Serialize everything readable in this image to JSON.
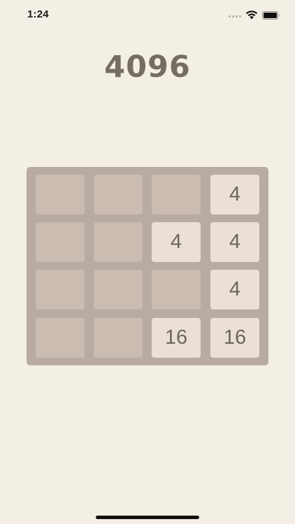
{
  "status_bar": {
    "time": "1:24",
    "icons": [
      "cellular-signal-icon",
      "wifi-icon",
      "battery-icon"
    ]
  },
  "game": {
    "title": "4096",
    "grid_size": 4,
    "tiles": [
      [
        "",
        "",
        "",
        "4"
      ],
      [
        "",
        "",
        "4",
        "4"
      ],
      [
        "",
        "",
        "",
        "4"
      ],
      [
        "",
        "",
        "16",
        "16"
      ]
    ]
  },
  "colors": {
    "background": "#f3efe5",
    "board": "#b8aba4",
    "empty_cell": "#cabcb1",
    "tile": "#eae0d7",
    "tile_text": "#6d655e",
    "title_text": "#756c64"
  }
}
